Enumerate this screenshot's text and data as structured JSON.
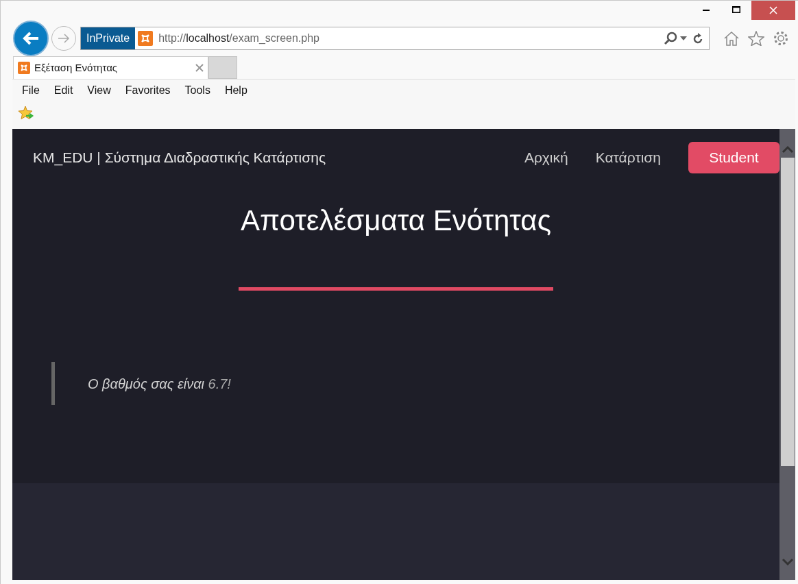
{
  "browser": {
    "inprivate": "InPrivate",
    "url_prefix": "http://",
    "url_host": "localhost",
    "url_path": "/exam_screen.php",
    "tabs": [
      {
        "title": "Εξέταση Ενότητας",
        "selected": true
      }
    ],
    "menu": [
      "File",
      "Edit",
      "View",
      "Favorites",
      "Tools",
      "Help"
    ]
  },
  "page": {
    "brand": "KM_EDU | Σύστημα Διαδραστικής Κατάρτισης",
    "nav": [
      {
        "label": "Αρχική",
        "kind": "link"
      },
      {
        "label": "Κατάρτιση",
        "kind": "link"
      },
      {
        "label": "Student",
        "kind": "button"
      }
    ],
    "heading": "Αποτελέσματα Ενότητας",
    "result": {
      "message": "Ο βαθμός σας είναι",
      "grade": "6.7!"
    }
  }
}
